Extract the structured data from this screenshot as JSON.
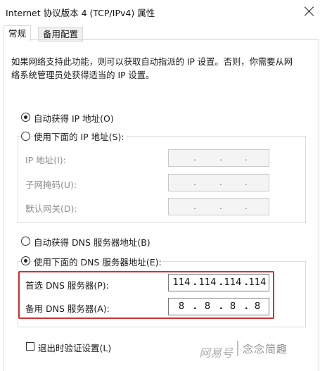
{
  "window": {
    "title": "Internet 协议版本 4 (TCP/IPv4) 属性"
  },
  "tabs": [
    {
      "label": "常规",
      "active": true
    },
    {
      "label": "备用配置",
      "active": false
    }
  ],
  "description": {
    "line1": "如果网络支持此功能，则可以获取自动指派的 IP 设置。否则，你需要从网",
    "line2": "络系统管理员处获得适当的 IP 设置。"
  },
  "ip_section": {
    "auto_label": "自动获得 IP 地址(O)",
    "auto_selected": true,
    "manual_label": "使用下面的 IP 地址(S):",
    "manual_selected": false,
    "fields": [
      {
        "label": "IP 地址(I):",
        "octets": [
          "",
          "",
          "",
          ""
        ]
      },
      {
        "label": "子网掩码(U):",
        "octets": [
          "",
          "",
          "",
          ""
        ]
      },
      {
        "label": "默认网关(D):",
        "octets": [
          "",
          "",
          "",
          ""
        ]
      }
    ]
  },
  "dns_section": {
    "auto_label": "自动获得 DNS 服务器地址(B)",
    "auto_selected": false,
    "manual_label": "使用下面的 DNS 服务器地址(E):",
    "manual_selected": true,
    "preferred": {
      "label": "首选 DNS 服务器(P):",
      "octets": [
        "114",
        "114",
        "114",
        "114"
      ]
    },
    "alternate": {
      "label": "备用 DNS 服务器(A):",
      "octets": [
        "8",
        "8",
        "8",
        "8"
      ]
    }
  },
  "validate_on_exit": {
    "label": "退出时验证设置(L)",
    "checked": false
  },
  "colors": {
    "highlight": "#cc3333"
  },
  "watermark": {
    "brand": "网易号",
    "account": "念念简趣"
  }
}
